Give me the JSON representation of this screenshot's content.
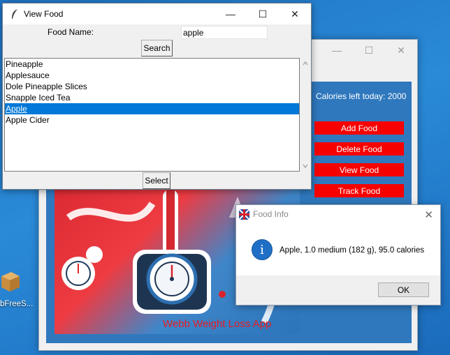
{
  "view_food": {
    "title": "View Food",
    "food_name_label": "Food Name:",
    "food_name_value": "apple",
    "search_label": "Search",
    "select_label": "Select",
    "results": [
      "Pineapple",
      "Applesauce",
      "Dole Pineapple Slices",
      "Snapple Iced Tea",
      "Apple",
      "Apple Cider"
    ],
    "selected_index": 4
  },
  "main_app": {
    "calories_left": "Calories left today: 2000",
    "buttons": [
      "Add Food",
      "Delete Food",
      "View Food",
      "Track Food"
    ],
    "poster_caption": "Webb Weight Loss App"
  },
  "food_info": {
    "title": "Food Info",
    "message": "Apple, 1.0 medium (182 g), 95.0 calories",
    "ok_label": "OK"
  },
  "desktop": {
    "icon_label": "bFreeS..."
  },
  "colors": {
    "accent_red": "#f70000",
    "selection_blue": "#0078d7",
    "main_panel": "#2f78bd"
  }
}
